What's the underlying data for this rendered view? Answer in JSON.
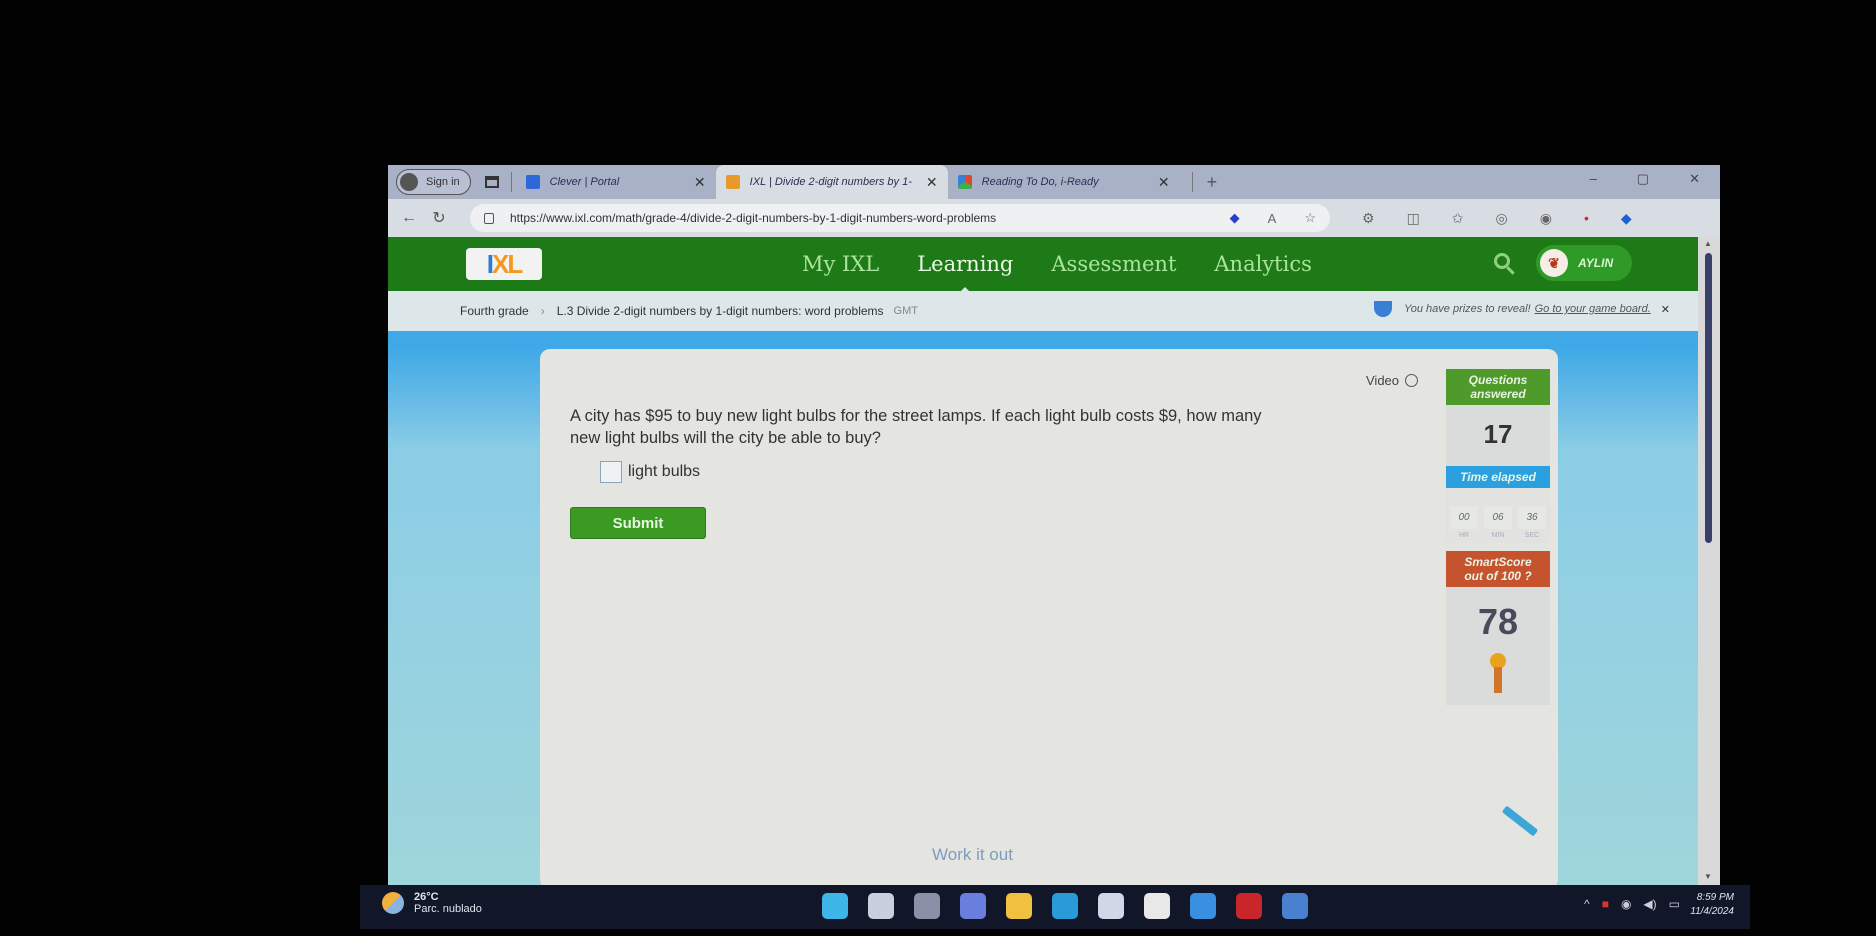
{
  "browser": {
    "signin_label": "Sign in",
    "tabs": [
      {
        "title": "Clever | Portal",
        "active": false,
        "favicon_color": "#2f66d8"
      },
      {
        "title": "IXL | Divide 2-digit numbers by 1-",
        "active": true,
        "favicon_color": "#e79a2a"
      },
      {
        "title": "Reading To Do, i-Ready",
        "active": false,
        "favicon_color": "#e0462e"
      }
    ],
    "new_tab_label": "+",
    "window_controls": [
      "–",
      "▢",
      "✕"
    ],
    "url": "https://www.ixl.com/math/grade-4/divide-2-digit-numbers-by-1-digit-numbers-word-problems",
    "nav_icons": [
      "back-icon",
      "refresh-icon"
    ],
    "address_icons": [
      "shopping-tag-icon",
      "read-aloud-icon",
      "favorite-star-icon"
    ],
    "toolbar_icons": [
      "extensions-icon",
      "split-screen-icon",
      "favorites-icon",
      "browser-essentials-icon",
      "profile-icon",
      "notifications-icon",
      "copilot-icon"
    ]
  },
  "ixl": {
    "logo": {
      "i": "I",
      "xl": "XL"
    },
    "nav": [
      "My IXL",
      "Learning",
      "Assessment",
      "Analytics"
    ],
    "active_nav": "Learning",
    "user_name": "AYLIN",
    "breadcrumb": {
      "grade": "Fourth grade",
      "skill": "L.3 Divide 2-digit numbers by 1-digit numbers: word problems",
      "code": "GMT"
    },
    "prize_banner": {
      "text": "You have prizes to reveal!",
      "link": "Go to your game board."
    }
  },
  "question": {
    "text": "A city has $95 to buy new light bulbs for the street lamps. If each light bulb costs $9, how many new light bulbs will the city be able to buy?",
    "answer_value": "",
    "answer_unit": "light bulbs",
    "submit_label": "Submit",
    "video_label": "Video",
    "work_it_out": "Work it out"
  },
  "stats": {
    "questions_header": "Questions answered",
    "questions_answered": "17",
    "time_header": "Time elapsed",
    "time": [
      {
        "value": "00",
        "unit": "HR"
      },
      {
        "value": "06",
        "unit": "MIN"
      },
      {
        "value": "36",
        "unit": "SEC"
      }
    ],
    "smartscore_header": "SmartScore",
    "smartscore_sub": "out of 100",
    "smartscore": "78"
  },
  "taskbar": {
    "temperature": "26°C",
    "weather": "Parc. nublado",
    "apps": [
      {
        "name": "start",
        "color": "#3fb6e8"
      },
      {
        "name": "search",
        "color": "#c8d0e0"
      },
      {
        "name": "task-view",
        "color": "#8a90a8"
      },
      {
        "name": "chat",
        "color": "#6a7ee0"
      },
      {
        "name": "file-explorer",
        "color": "#f0c040"
      },
      {
        "name": "edge",
        "color": "#2a9ad8"
      },
      {
        "name": "store",
        "color": "#d0d8e8"
      },
      {
        "name": "app-circle",
        "color": "#e8e8e8"
      },
      {
        "name": "app-blue-swirl",
        "color": "#3a90e0"
      },
      {
        "name": "mcafee",
        "color": "#c8262a"
      },
      {
        "name": "app-calculator",
        "color": "#4a80d0"
      }
    ],
    "tray_icons": [
      "chevron-up-icon",
      "antivirus-icon",
      "network-icon",
      "volume-icon",
      "battery-icon"
    ],
    "time": "8:59 PM",
    "date": "11/4/2024"
  }
}
